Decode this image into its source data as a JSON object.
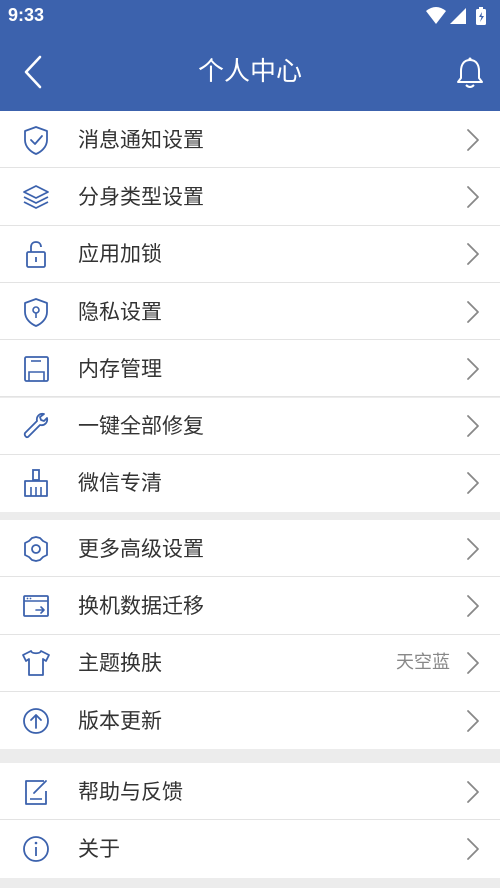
{
  "status_bar": {
    "time": "9:33"
  },
  "header": {
    "title": "个人中心"
  },
  "colors": {
    "brand": "#3c62ad",
    "icon": "#3c62ad"
  },
  "groups": [
    {
      "items": [
        {
          "label": "消息通知设置",
          "icon": "shield-check-icon"
        },
        {
          "label": "分身类型设置",
          "icon": "layers-icon"
        },
        {
          "label": "应用加锁",
          "icon": "lock-icon"
        },
        {
          "label": "隐私设置",
          "icon": "privacy-shield-icon"
        },
        {
          "label": "内存管理",
          "icon": "floppy-icon"
        },
        {
          "label": "一键全部修复",
          "icon": "wrench-icon"
        },
        {
          "label": "微信专清",
          "icon": "broom-icon"
        }
      ]
    },
    {
      "items": [
        {
          "label": "更多高级设置",
          "icon": "gear-icon"
        },
        {
          "label": "换机数据迁移",
          "icon": "transfer-icon"
        },
        {
          "label": "主题换肤",
          "icon": "tshirt-icon",
          "value": "天空蓝"
        },
        {
          "label": "版本更新",
          "icon": "upgrade-icon"
        }
      ]
    },
    {
      "items": [
        {
          "label": "帮助与反馈",
          "icon": "feedback-icon"
        },
        {
          "label": "关于",
          "icon": "info-icon"
        }
      ]
    }
  ]
}
